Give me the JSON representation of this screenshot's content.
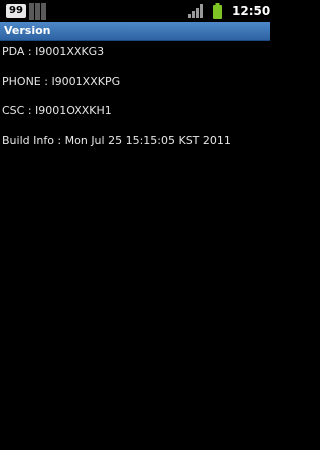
{
  "status_bar": {
    "notification_count": "99",
    "time": "12:50",
    "icons": [
      "notification-badge-icon",
      "notification-bars-icon",
      "signal-icon",
      "battery-icon"
    ]
  },
  "title_bar": {
    "title": "Version"
  },
  "info": {
    "pda": "PDA : I9001XXKG3",
    "phone": "PHONE : I9001XXKPG",
    "csc": "CSC : I9001OXXKH1",
    "build": "Build Info : Mon Jul 25 15:15:05 KST 2011"
  },
  "colors": {
    "title_bar": "#3a74b8",
    "background": "#000000",
    "text": "#e6e6e6",
    "battery": "#7ec424"
  }
}
